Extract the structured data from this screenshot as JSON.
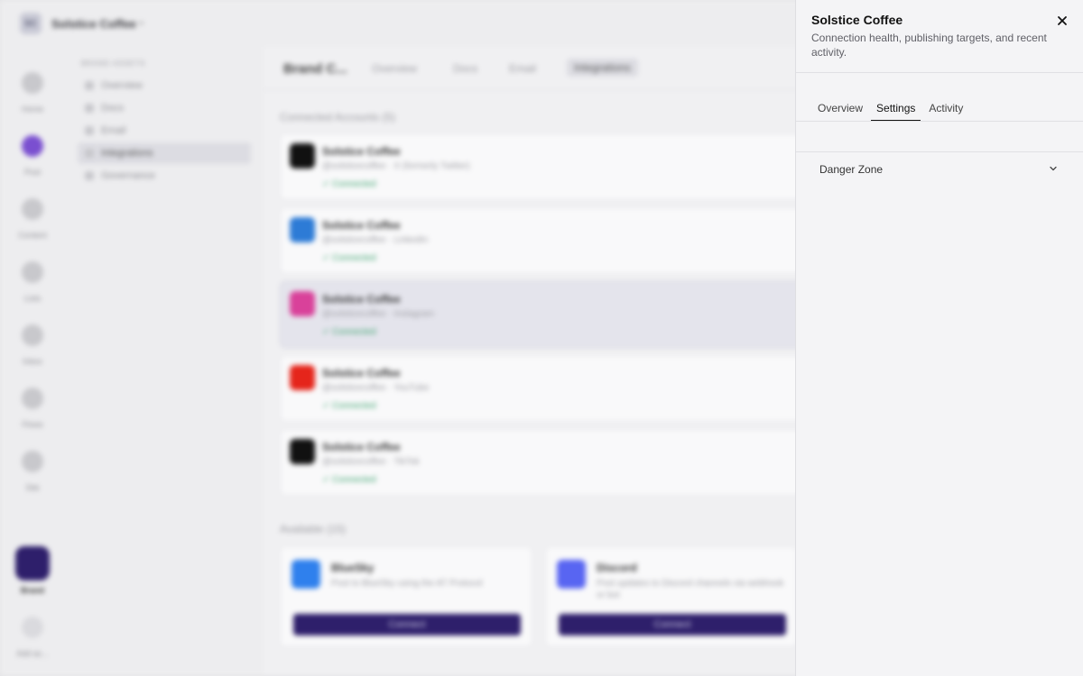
{
  "workspace": {
    "initials": "SC",
    "name": "Solstice Coffee"
  },
  "rail": [
    {
      "label": "Home",
      "icon": "home-icon"
    },
    {
      "label": "Post",
      "icon": "post-icon"
    },
    {
      "label": "Content",
      "icon": "content-icon"
    },
    {
      "label": "Lists",
      "icon": "lists-icon"
    },
    {
      "label": "Inbox",
      "icon": "inbox-icon"
    },
    {
      "label": "Flows",
      "icon": "flows-icon"
    },
    {
      "label": "Site",
      "icon": "site-icon"
    },
    {
      "label": "Brand",
      "icon": "brand-icon",
      "active": true
    },
    {
      "label": "Add ac...",
      "icon": "plus-icon"
    }
  ],
  "subnav": {
    "heading": "BRAND ASSETS",
    "items": [
      {
        "label": "Overview"
      },
      {
        "label": "Docs"
      },
      {
        "label": "Email"
      },
      {
        "label": "Integrations",
        "active": true
      },
      {
        "label": "Governance"
      }
    ]
  },
  "content": {
    "title": "Brand C...",
    "tabs": [
      "Overview",
      "Docs",
      "Email",
      "Integrations"
    ],
    "connected_label": "Connected Accounts (5)",
    "accounts": [
      {
        "name": "Solstice Coffee",
        "sub": "@solsticecoffee · X (formerly Twitter)",
        "status": "Connected",
        "color": "#111111"
      },
      {
        "name": "Solstice Coffee",
        "sub": "@solsticecoffee · LinkedIn",
        "status": "Connected",
        "color": "#2d7bd6"
      },
      {
        "name": "Solstice Coffee",
        "sub": "@solsticecoffee · Instagram",
        "status": "Connected",
        "color": "#d9419a"
      },
      {
        "name": "Solstice Coffee",
        "sub": "@solsticecoffee · YouTube",
        "status": "Connected",
        "color": "#e5251b"
      },
      {
        "name": "Solstice Coffee",
        "sub": "@solsticecoffee · TikTok",
        "status": "Connected",
        "color": "#111111"
      }
    ],
    "available_label": "Available (15)",
    "available": [
      {
        "name": "BlueSky",
        "desc": "Post to BlueSky using the AT Protocol",
        "button": "Connect",
        "color": "#2f80ed"
      },
      {
        "name": "Discord",
        "desc": "Post updates to Discord channels via webhook or bot",
        "button": "Connect",
        "color": "#5865f2"
      }
    ]
  },
  "panel": {
    "title": "Solstice Coffee",
    "subtitle": "Connection health, publishing targets, and recent activity.",
    "tabs": [
      {
        "label": "Overview"
      },
      {
        "label": "Settings",
        "active": true
      },
      {
        "label": "Activity"
      }
    ],
    "sections": [
      {
        "label": "Danger Zone",
        "expanded": false
      }
    ]
  }
}
